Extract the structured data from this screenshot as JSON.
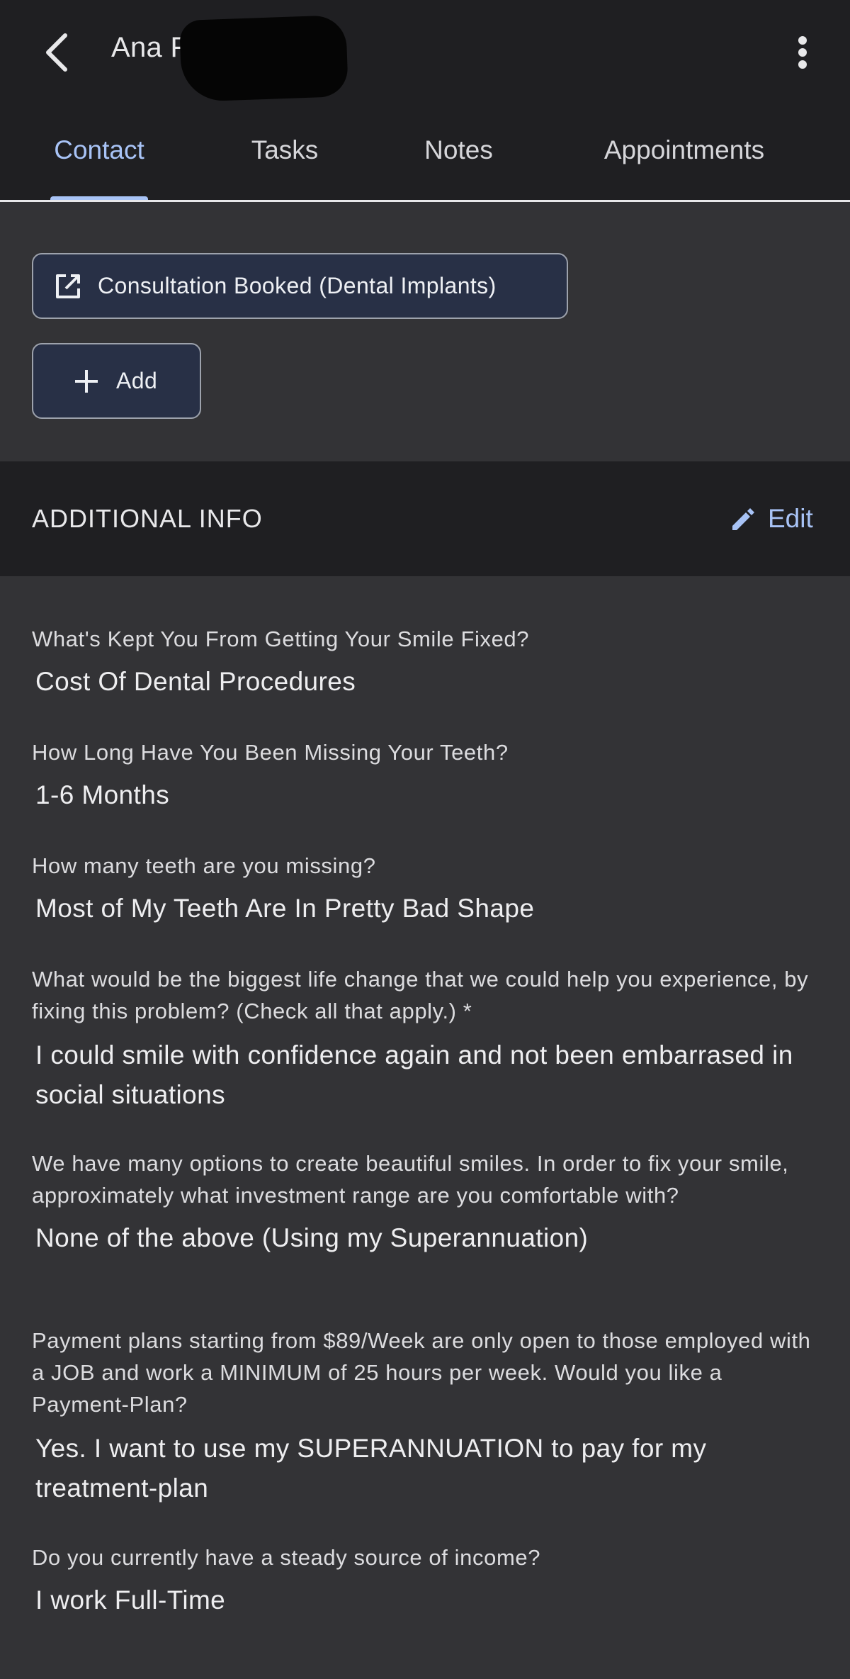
{
  "header": {
    "contact_name": "Ana F",
    "tabs": [
      {
        "label": "Contact",
        "active": true
      },
      {
        "label": "Tasks",
        "active": false
      },
      {
        "label": "Notes",
        "active": false
      },
      {
        "label": "Appointments",
        "active": false
      }
    ],
    "accent_color": "#a8c3f6"
  },
  "pipeline": {
    "opportunity_label": "Consultation Booked (Dental Implants)",
    "add_label": "Add"
  },
  "additional_info": {
    "title": "ADDITIONAL INFO",
    "edit_label": "Edit",
    "fields": [
      {
        "question": "What's Kept You From Getting Your Smile Fixed?",
        "answer": "Cost Of Dental Procedures"
      },
      {
        "question": "How Long Have You Been Missing Your Teeth?",
        "answer": "1-6 Months"
      },
      {
        "question": "How many teeth are you missing?",
        "answer": "Most of My Teeth Are In Pretty Bad Shape"
      },
      {
        "question": "What would be the biggest life change that we could help you experience, by fixing this problem? (Check all that apply.) *",
        "answer": "I could smile with confidence again and not been embarrased in social situations"
      },
      {
        "question": "We have many options to create beautiful smiles. In order to fix your smile, approximately what investment range are you comfortable with?",
        "answer": "None of the above (Using my Superannuation)"
      },
      {
        "question": "Payment plans starting from $89/Week are only open to those employed with a JOB and work a MINIMUM of 25 hours per week. Would you like a Payment-Plan?",
        "answer": "Yes. I want to use my SUPERANNUATION to pay for my treatment-plan"
      },
      {
        "question": "Do you currently have a steady source of income?",
        "answer": "I work Full-Time"
      }
    ]
  }
}
